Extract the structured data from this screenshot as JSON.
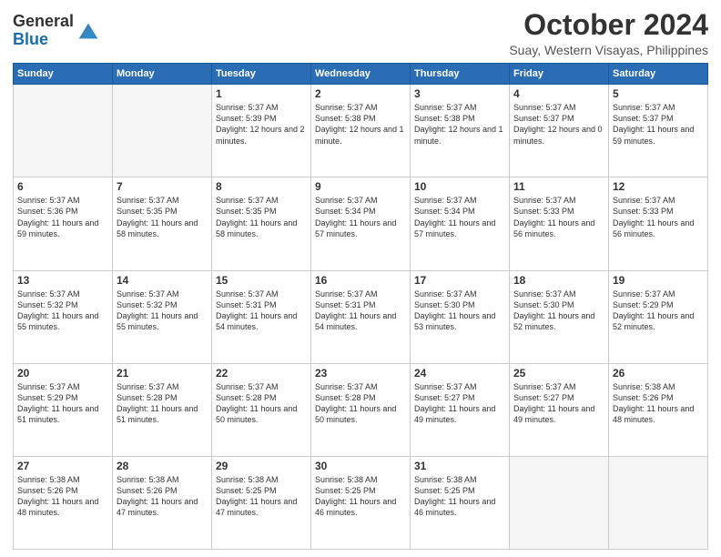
{
  "header": {
    "logo_general": "General",
    "logo_blue": "Blue",
    "month_title": "October 2024",
    "location": "Suay, Western Visayas, Philippines"
  },
  "days_of_week": [
    "Sunday",
    "Monday",
    "Tuesday",
    "Wednesday",
    "Thursday",
    "Friday",
    "Saturday"
  ],
  "weeks": [
    [
      {
        "day": "",
        "empty": true
      },
      {
        "day": "",
        "empty": true
      },
      {
        "day": "1",
        "sunrise": "5:37 AM",
        "sunset": "5:39 PM",
        "daylight": "12 hours and 2 minutes."
      },
      {
        "day": "2",
        "sunrise": "5:37 AM",
        "sunset": "5:38 PM",
        "daylight": "12 hours and 1 minute."
      },
      {
        "day": "3",
        "sunrise": "5:37 AM",
        "sunset": "5:38 PM",
        "daylight": "12 hours and 1 minute."
      },
      {
        "day": "4",
        "sunrise": "5:37 AM",
        "sunset": "5:37 PM",
        "daylight": "12 hours and 0 minutes."
      },
      {
        "day": "5",
        "sunrise": "5:37 AM",
        "sunset": "5:37 PM",
        "daylight": "11 hours and 59 minutes."
      }
    ],
    [
      {
        "day": "6",
        "sunrise": "5:37 AM",
        "sunset": "5:36 PM",
        "daylight": "11 hours and 59 minutes."
      },
      {
        "day": "7",
        "sunrise": "5:37 AM",
        "sunset": "5:35 PM",
        "daylight": "11 hours and 58 minutes."
      },
      {
        "day": "8",
        "sunrise": "5:37 AM",
        "sunset": "5:35 PM",
        "daylight": "11 hours and 58 minutes."
      },
      {
        "day": "9",
        "sunrise": "5:37 AM",
        "sunset": "5:34 PM",
        "daylight": "11 hours and 57 minutes."
      },
      {
        "day": "10",
        "sunrise": "5:37 AM",
        "sunset": "5:34 PM",
        "daylight": "11 hours and 57 minutes."
      },
      {
        "day": "11",
        "sunrise": "5:37 AM",
        "sunset": "5:33 PM",
        "daylight": "11 hours and 56 minutes."
      },
      {
        "day": "12",
        "sunrise": "5:37 AM",
        "sunset": "5:33 PM",
        "daylight": "11 hours and 56 minutes."
      }
    ],
    [
      {
        "day": "13",
        "sunrise": "5:37 AM",
        "sunset": "5:32 PM",
        "daylight": "11 hours and 55 minutes."
      },
      {
        "day": "14",
        "sunrise": "5:37 AM",
        "sunset": "5:32 PM",
        "daylight": "11 hours and 55 minutes."
      },
      {
        "day": "15",
        "sunrise": "5:37 AM",
        "sunset": "5:31 PM",
        "daylight": "11 hours and 54 minutes."
      },
      {
        "day": "16",
        "sunrise": "5:37 AM",
        "sunset": "5:31 PM",
        "daylight": "11 hours and 54 minutes."
      },
      {
        "day": "17",
        "sunrise": "5:37 AM",
        "sunset": "5:30 PM",
        "daylight": "11 hours and 53 minutes."
      },
      {
        "day": "18",
        "sunrise": "5:37 AM",
        "sunset": "5:30 PM",
        "daylight": "11 hours and 52 minutes."
      },
      {
        "day": "19",
        "sunrise": "5:37 AM",
        "sunset": "5:29 PM",
        "daylight": "11 hours and 52 minutes."
      }
    ],
    [
      {
        "day": "20",
        "sunrise": "5:37 AM",
        "sunset": "5:29 PM",
        "daylight": "11 hours and 51 minutes."
      },
      {
        "day": "21",
        "sunrise": "5:37 AM",
        "sunset": "5:28 PM",
        "daylight": "11 hours and 51 minutes."
      },
      {
        "day": "22",
        "sunrise": "5:37 AM",
        "sunset": "5:28 PM",
        "daylight": "11 hours and 50 minutes."
      },
      {
        "day": "23",
        "sunrise": "5:37 AM",
        "sunset": "5:28 PM",
        "daylight": "11 hours and 50 minutes."
      },
      {
        "day": "24",
        "sunrise": "5:37 AM",
        "sunset": "5:27 PM",
        "daylight": "11 hours and 49 minutes."
      },
      {
        "day": "25",
        "sunrise": "5:37 AM",
        "sunset": "5:27 PM",
        "daylight": "11 hours and 49 minutes."
      },
      {
        "day": "26",
        "sunrise": "5:38 AM",
        "sunset": "5:26 PM",
        "daylight": "11 hours and 48 minutes."
      }
    ],
    [
      {
        "day": "27",
        "sunrise": "5:38 AM",
        "sunset": "5:26 PM",
        "daylight": "11 hours and 48 minutes."
      },
      {
        "day": "28",
        "sunrise": "5:38 AM",
        "sunset": "5:26 PM",
        "daylight": "11 hours and 47 minutes."
      },
      {
        "day": "29",
        "sunrise": "5:38 AM",
        "sunset": "5:25 PM",
        "daylight": "11 hours and 47 minutes."
      },
      {
        "day": "30",
        "sunrise": "5:38 AM",
        "sunset": "5:25 PM",
        "daylight": "11 hours and 46 minutes."
      },
      {
        "day": "31",
        "sunrise": "5:38 AM",
        "sunset": "5:25 PM",
        "daylight": "11 hours and 46 minutes."
      },
      {
        "day": "",
        "empty": true
      },
      {
        "day": "",
        "empty": true
      }
    ]
  ],
  "labels": {
    "sunrise": "Sunrise:",
    "sunset": "Sunset:",
    "daylight": "Daylight:"
  }
}
